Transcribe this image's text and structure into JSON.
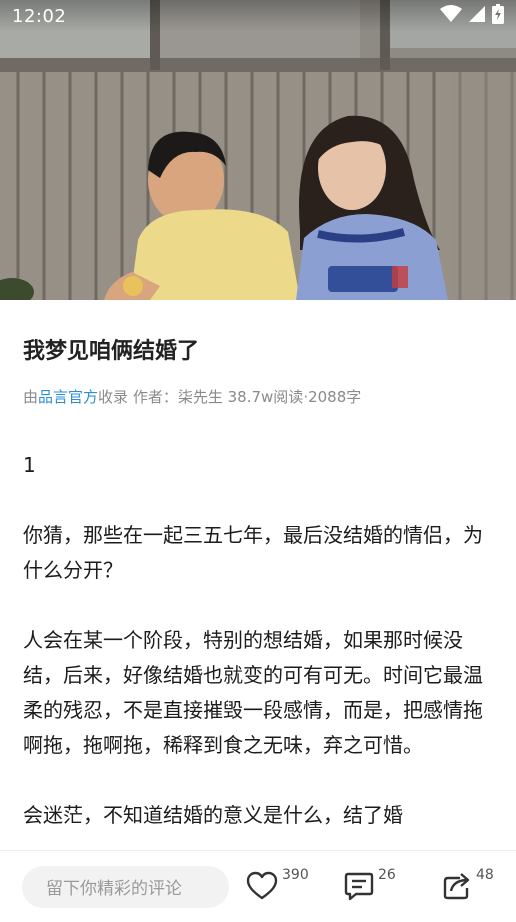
{
  "status_bar": {
    "time": "12:02"
  },
  "article": {
    "title": "我梦见咱俩结婚了",
    "meta": {
      "prefix": "由",
      "collection_name": "品言官方",
      "collected_label": "收录",
      "author_label": "作者：",
      "author_name": "柒先生",
      "reads": "38.7w阅读",
      "separator": "·",
      "word_count": "2088字"
    },
    "paragraphs": [
      "1",
      "你猜，那些在一起三五七年，最后没结婚的情侣，为什么分开？",
      "人会在某一个阶段，特别的想结婚，如果那时候没结，后来，好像结婚也就变的可有可无。时间它最温柔的残忍，不是直接摧毁一段感情，而是，把感情拖啊拖，拖啊拖，稀释到食之无味，弃之可惜。",
      "会迷茫，不知道结婚的意义是什么，结了婚"
    ]
  },
  "bottom_bar": {
    "comment_placeholder": "留下你精彩的评论",
    "like_count": "390",
    "comment_count": "26",
    "share_count": "48"
  },
  "colors": {
    "link": "#2c8ed6",
    "meta": "#8a8a8a",
    "input_bg": "#f2f2f2"
  },
  "icons": [
    "wifi-icon",
    "signal-icon",
    "battery-charging-icon",
    "heart-icon",
    "comment-icon",
    "share-icon"
  ]
}
